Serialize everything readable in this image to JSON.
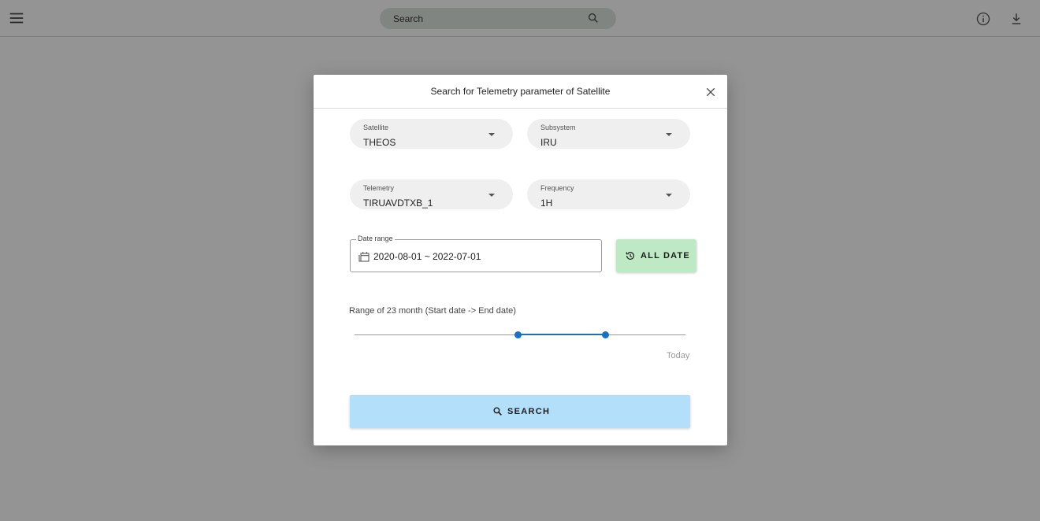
{
  "appbar": {
    "menu_icon": "hamburger-menu-icon",
    "search": {
      "placeholder": "Search",
      "icon": "search-icon"
    },
    "info_icon": "info-icon",
    "download_icon": "download-icon"
  },
  "dialog": {
    "title": "Search for Telemetry parameter of Satellite",
    "close_icon": "close-icon",
    "fields": {
      "satellite": {
        "label": "Satellite",
        "value": "THEOS"
      },
      "subsystem": {
        "label": "Subsystem",
        "value": "IRU"
      },
      "telemetry": {
        "label": "Telemetry",
        "value": "TIRUAVDTXB_1"
      },
      "frequency": {
        "label": "Frequency",
        "value": "1H"
      }
    },
    "date_range": {
      "label": "Date range",
      "value": "2020-08-01 ~ 2022-07-01",
      "icon": "calendar-icon"
    },
    "all_date_button": {
      "label": "ALL DATE",
      "icon": "history-clock-icon"
    },
    "range": {
      "label": "Range of 23 month (Start date -> End date)",
      "start_fraction": 0.493,
      "end_fraction": 0.757,
      "end_label": "Today"
    },
    "search_button": {
      "label": "SEARCH",
      "icon": "search-icon"
    }
  },
  "colors": {
    "backdrop": "#000000",
    "all_date_bg": "#bfe8c4",
    "search_bg": "#b4dffa",
    "slider_accent": "#1670c8",
    "select_bg": "#efefef"
  }
}
